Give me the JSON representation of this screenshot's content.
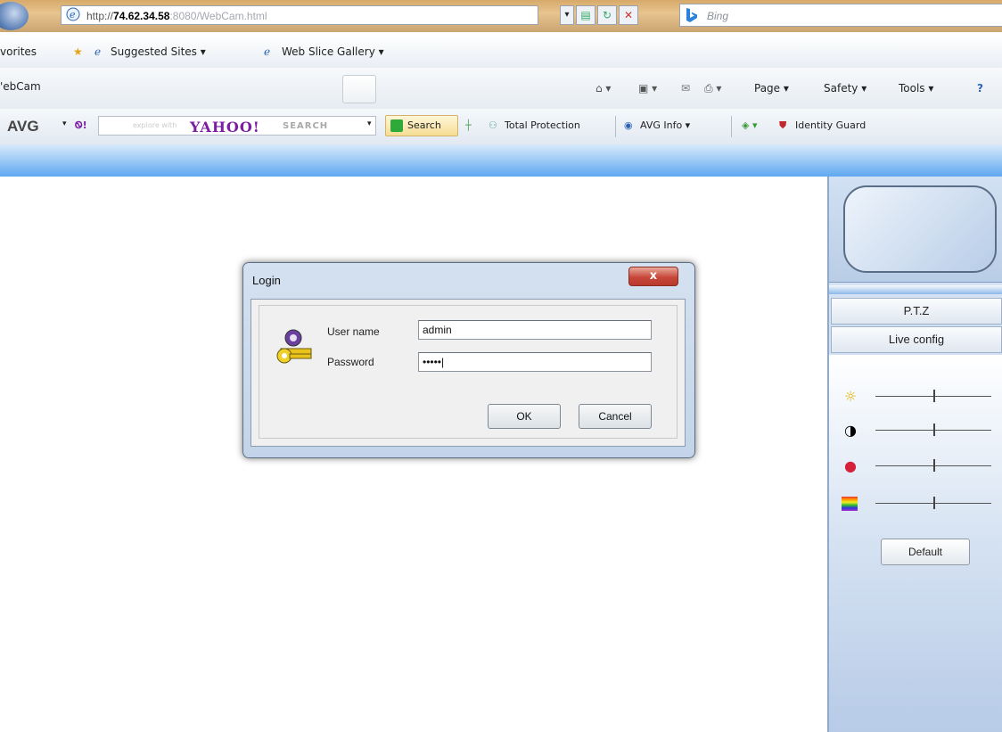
{
  "browser": {
    "url_prefix": "http://",
    "url_host": "74.62.34.58",
    "url_rest": ":8080/WebCam.html",
    "search_placeholder": "Bing",
    "favorites_label": "vorites",
    "fav_items": [
      "Suggested Sites ▾",
      "Web Slice Gallery ▾"
    ],
    "tab_title": "'ebCam",
    "commands": [
      "Page ▾",
      "Safety ▾",
      "Tools ▾"
    ],
    "toolbar": {
      "avg_label": "AVG",
      "yahoo_prefix": "explore with",
      "yahoo_logo": "YAHOO!",
      "yahoo_search": "SEARCH",
      "search_button": "Search",
      "total_protection": "Total Protection",
      "avg_info": "AVG Info ▾",
      "identity_guard": "Identity Guard"
    }
  },
  "panel": {
    "tabs": [
      "P.T.Z",
      "Live config"
    ],
    "sliders": [
      {
        "name": "brightness",
        "icon": "☼",
        "level": 0.5
      },
      {
        "name": "contrast",
        "icon": "◑",
        "level": 0.5
      },
      {
        "name": "saturation",
        "icon": "●",
        "level": 0.5
      },
      {
        "name": "hue",
        "icon": "▬",
        "level": 0.5
      }
    ],
    "default_button": "Default"
  },
  "dialog": {
    "title": "Login",
    "close_glyph": "x",
    "username_label": "User name",
    "username_value": "admin",
    "password_label": "Password",
    "password_value": "•••••|",
    "ok_label": "OK",
    "cancel_label": "Cancel"
  }
}
